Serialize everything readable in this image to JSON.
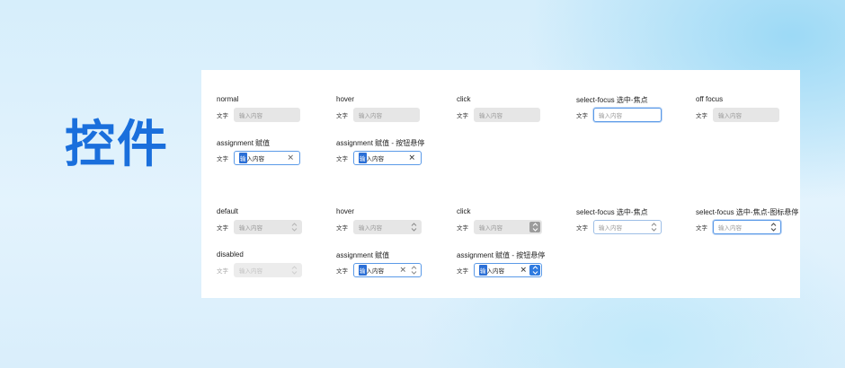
{
  "heading": "控件",
  "prefix": "文字",
  "placeholder": "输入内容",
  "assigned_value": {
    "selected_part": "输",
    "rest": "入内容"
  },
  "clear_glyph": "✕",
  "section_text": {
    "labels": [
      "normal",
      "hover",
      "click",
      "select-focus 选中-焦点",
      "off focus"
    ],
    "assign_labels": [
      "assignment 赋值",
      "assignment 赋值 - 按钮悬停"
    ]
  },
  "section_stepper": {
    "labels": [
      "default",
      "hover",
      "click",
      "select-focus 选中-焦点",
      "select-focus 选中-焦点-图标悬停"
    ],
    "row2_labels": [
      "disabled",
      "assignment 赋值",
      "assignment 赋值 - 按钮悬停"
    ]
  },
  "colors": {
    "accent": "#1a6fdc",
    "focus_border": "#5b9ae8",
    "selection": "#2b6fd6",
    "fill": "#e6e6e6"
  }
}
